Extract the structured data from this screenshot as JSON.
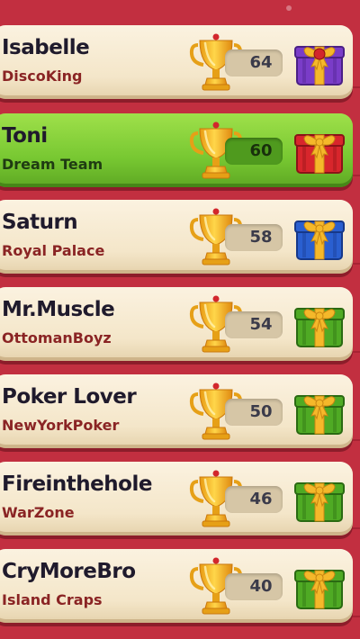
{
  "leaderboard": {
    "rows": [
      {
        "name": "Isabelle",
        "team": "DiscoKing",
        "score": "64",
        "gift": "purple",
        "highlight": false
      },
      {
        "name": "Toni",
        "team": "Dream Team",
        "score": "60",
        "gift": "red",
        "highlight": true
      },
      {
        "name": "Saturn",
        "team": "Royal Palace",
        "score": "58",
        "gift": "blue",
        "highlight": false
      },
      {
        "name": "Mr.Muscle",
        "team": "OttomanBoyz",
        "score": "54",
        "gift": "green",
        "highlight": false
      },
      {
        "name": "Poker Lover",
        "team": "NewYorkPoker",
        "score": "50",
        "gift": "green",
        "highlight": false
      },
      {
        "name": "Fireinthehole",
        "team": "WarZone",
        "score": "46",
        "gift": "green",
        "highlight": false
      },
      {
        "name": "CryMoreBro",
        "team": "Island Craps",
        "score": "40",
        "gift": "green",
        "highlight": false
      }
    ]
  },
  "icons": {
    "trophy": "trophy-icon",
    "gift": "gift-box-icon"
  },
  "colors": {
    "background": "#c22f40",
    "row": "#f4e6c9",
    "highlight_row": "#78c832",
    "name_text": "#1f1a2c",
    "team_text": "#8a2424",
    "gift_purple": "#7a3cc8",
    "gift_red": "#d8262c",
    "gift_blue": "#2a5fd0",
    "gift_green": "#4faa24",
    "ribbon": "#f5b82a"
  }
}
